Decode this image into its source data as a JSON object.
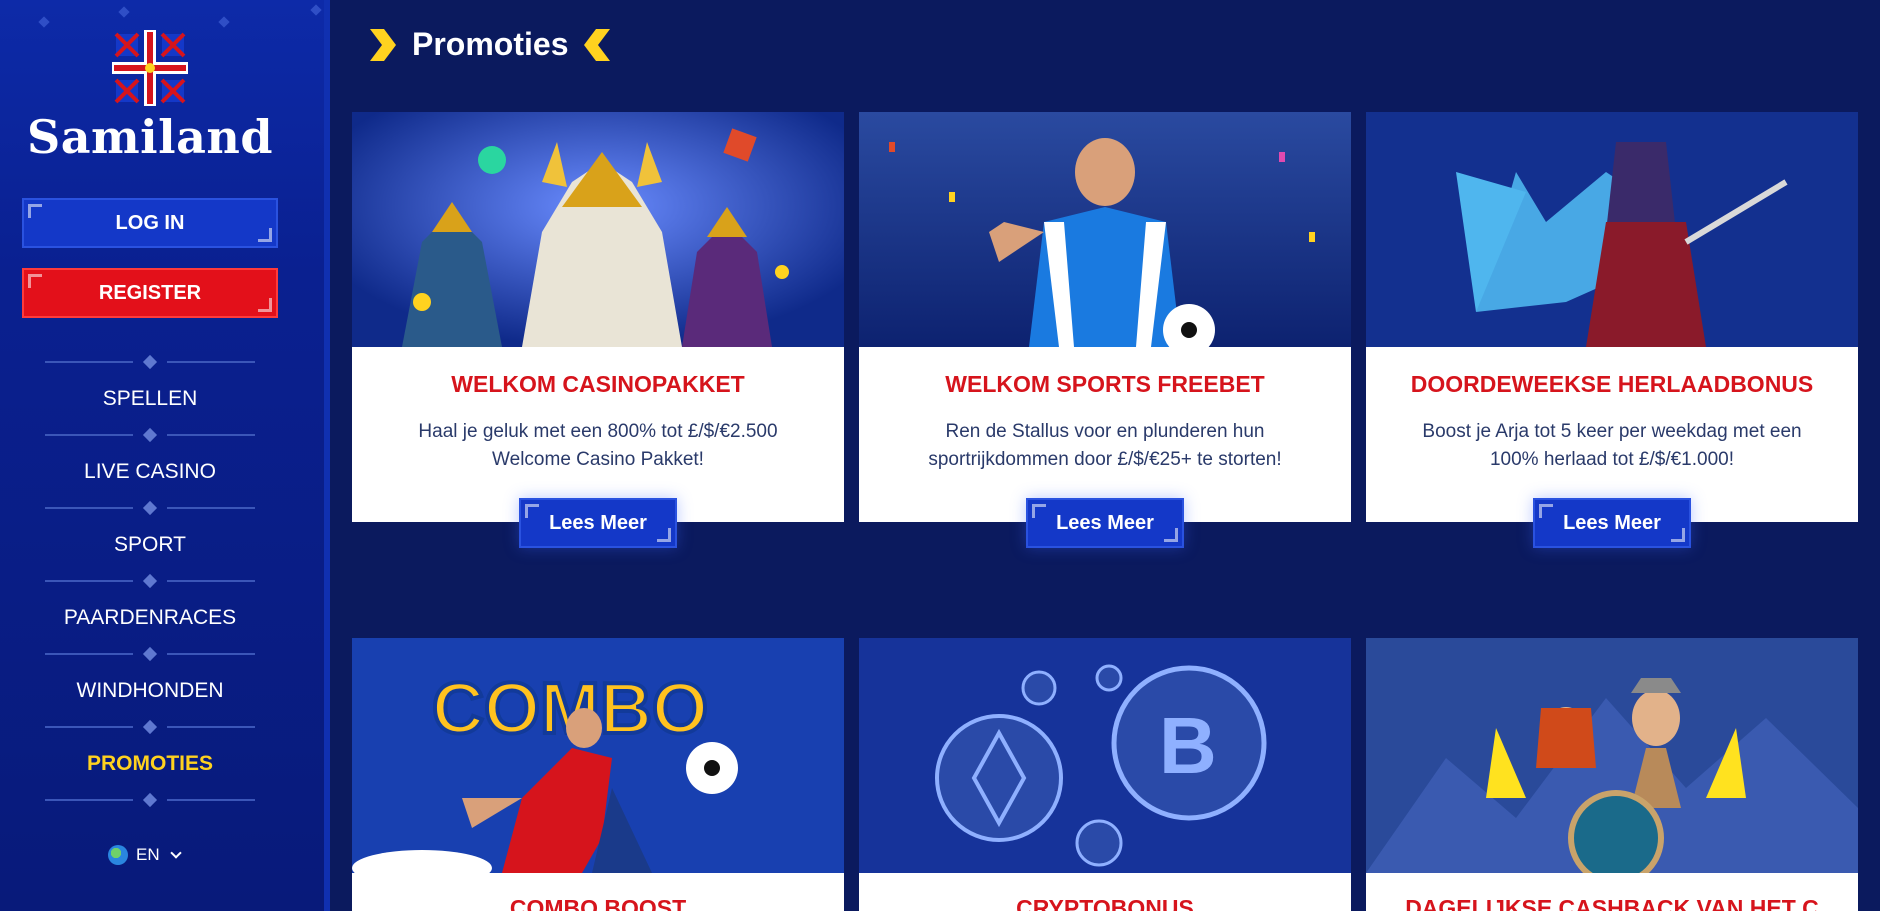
{
  "brand": {
    "name": "Samiland"
  },
  "auth": {
    "login_label": "LOG IN",
    "register_label": "REGISTER"
  },
  "nav": {
    "items": [
      {
        "label": "SPELLEN"
      },
      {
        "label": "LIVE CASINO"
      },
      {
        "label": "SPORT"
      },
      {
        "label": "PAARDENRACES"
      },
      {
        "label": "WINDHONDEN"
      },
      {
        "label": "PROMOTIES",
        "active": true
      }
    ]
  },
  "language": {
    "code": "EN"
  },
  "page": {
    "title": "Promoties"
  },
  "promos": [
    {
      "title": "WELKOM CASINOPAKKET",
      "description": "Haal je geluk met een 800% tot £/$/€2.500 Welcome Casino Pakket!",
      "button": "Lees Meer"
    },
    {
      "title": "WELKOM SPORTS FREEBET",
      "description": "Ren de Stallus voor en plunderen hun sportrijkdommen door £/$/€25+ te storten!",
      "button": "Lees Meer"
    },
    {
      "title": "DOORDEWEEKSE HERLAADBONUS",
      "description": "Boost je Arja tot 5 keer per weekdag met een 100% herlaad tot £/$/€1.000!",
      "button": "Lees Meer"
    },
    {
      "title": "COMBO BOOST"
    },
    {
      "title": "CRYPTOBONUS"
    },
    {
      "title": "DAGELIJKSE CASHBACK VAN HET C"
    }
  ],
  "colors": {
    "accent_red": "#d6141c",
    "button_blue": "#1438c8",
    "active_yellow": "#ffd21f",
    "background": "#0b1a5e"
  }
}
